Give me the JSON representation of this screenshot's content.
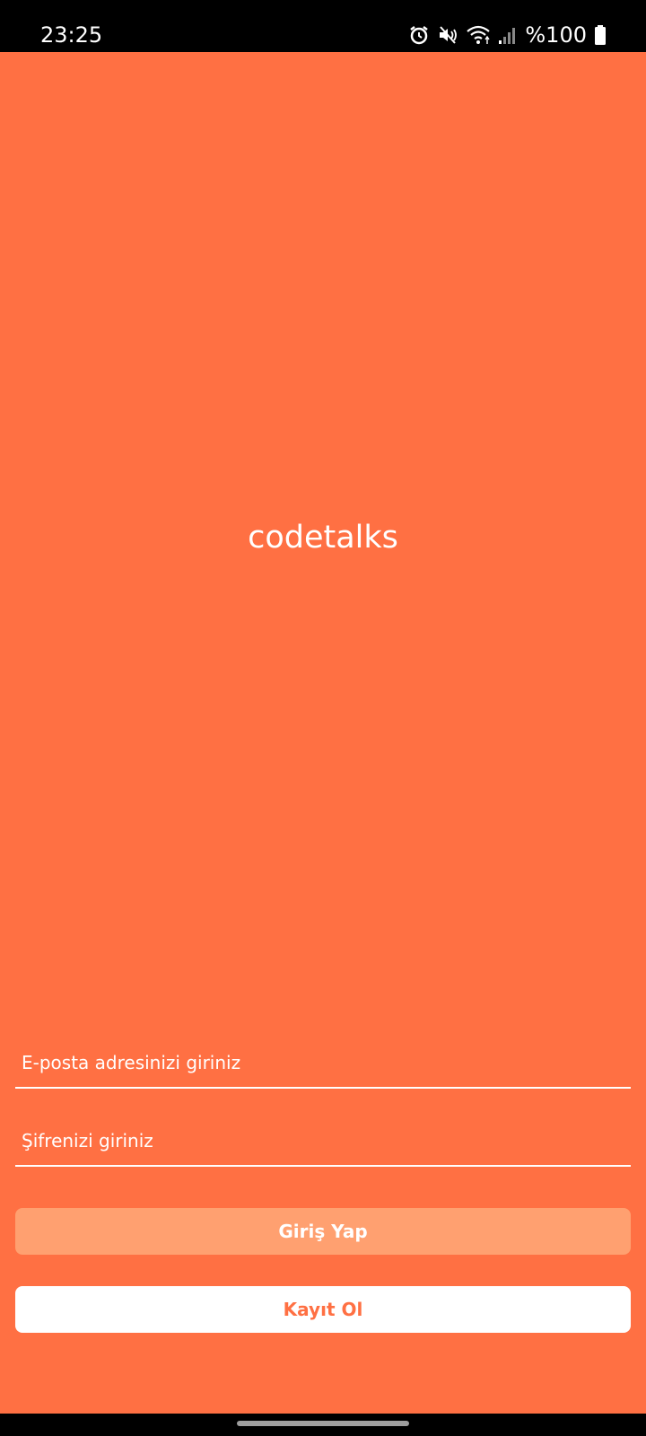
{
  "status_bar": {
    "time": "23:25",
    "battery": "%100",
    "icons": [
      "alarm-icon",
      "mute-icon",
      "wifi-icon",
      "signal-icon",
      "battery-icon"
    ]
  },
  "app": {
    "title": "codetalks",
    "background_color": "#ff7043"
  },
  "form": {
    "email_placeholder": "E-posta adresinizi giriniz",
    "email_value": "",
    "password_placeholder": "Şifrenizi giriniz",
    "password_value": "",
    "login_label": "Giriş Yap",
    "register_label": "Kayıt Ol"
  },
  "colors": {
    "accent": "#ff7043",
    "login_button": "#ffa070",
    "register_button": "#ffffff"
  }
}
